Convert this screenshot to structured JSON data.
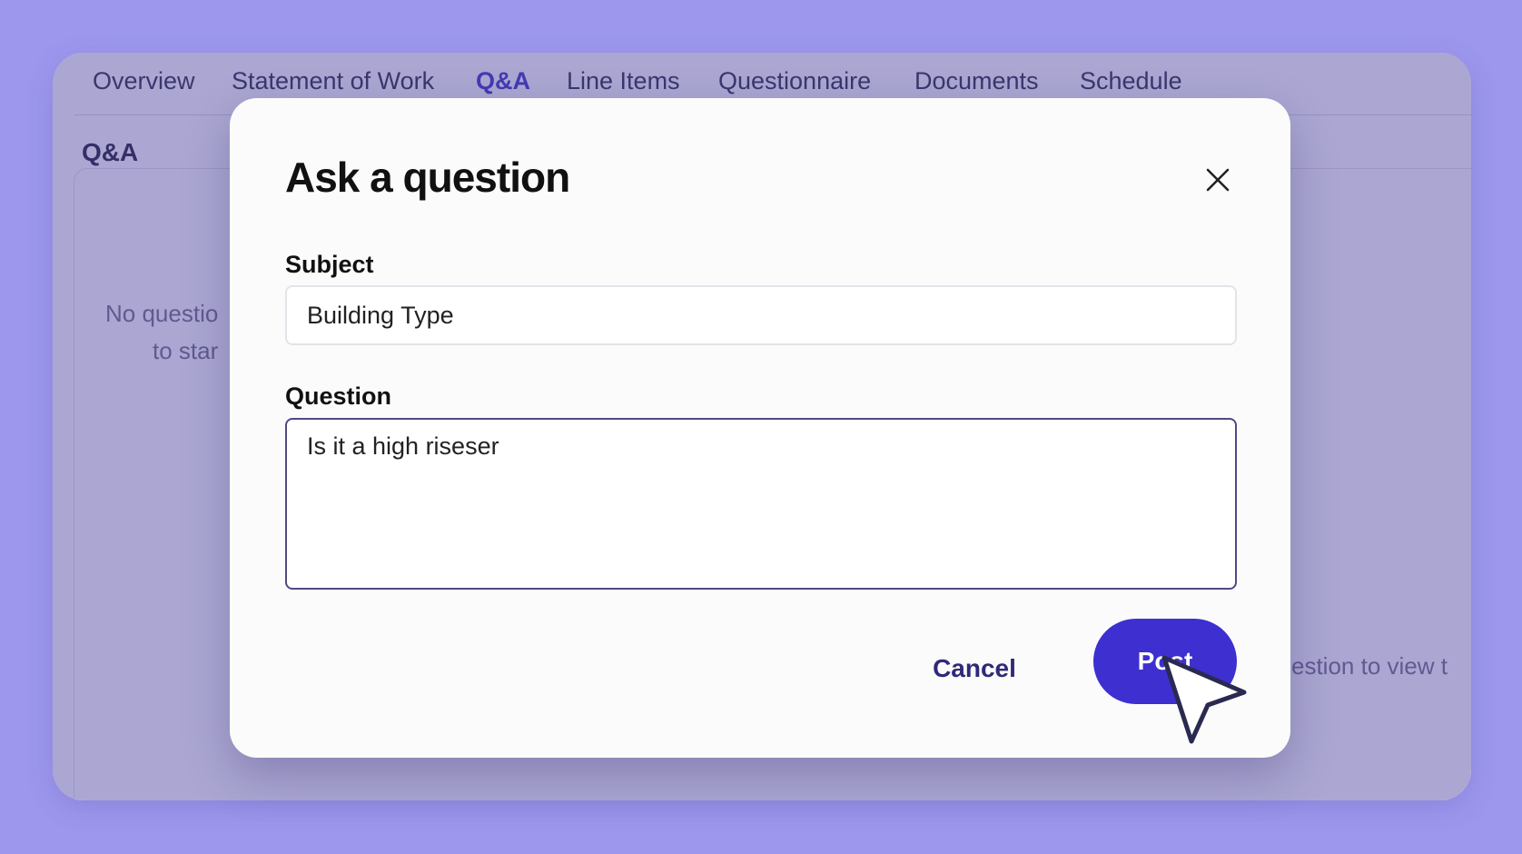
{
  "tabs": [
    {
      "label": "Overview"
    },
    {
      "label": "Statement of Work"
    },
    {
      "label": "Q&A"
    },
    {
      "label": "Line Items"
    },
    {
      "label": "Questionnaire"
    },
    {
      "label": "Documents"
    },
    {
      "label": "Schedule"
    }
  ],
  "active_tab": "Q&A",
  "panel": {
    "title": "Q&A",
    "empty_line_1": "No questio",
    "empty_line_2": "to star",
    "right_hint": "estion to view t"
  },
  "modal": {
    "title": "Ask a question",
    "subject_label": "Subject",
    "subject_value": "Building Type",
    "question_label": "Question",
    "question_value": "Is it a high riseser",
    "cancel_label": "Cancel",
    "post_label": "Post"
  },
  "colors": {
    "background": "#9d98ee",
    "accent": "#3d2fd0",
    "active_tab": "#3a2fc4"
  },
  "icons": {
    "close": "close-icon",
    "cursor": "mouse-pointer-icon"
  }
}
